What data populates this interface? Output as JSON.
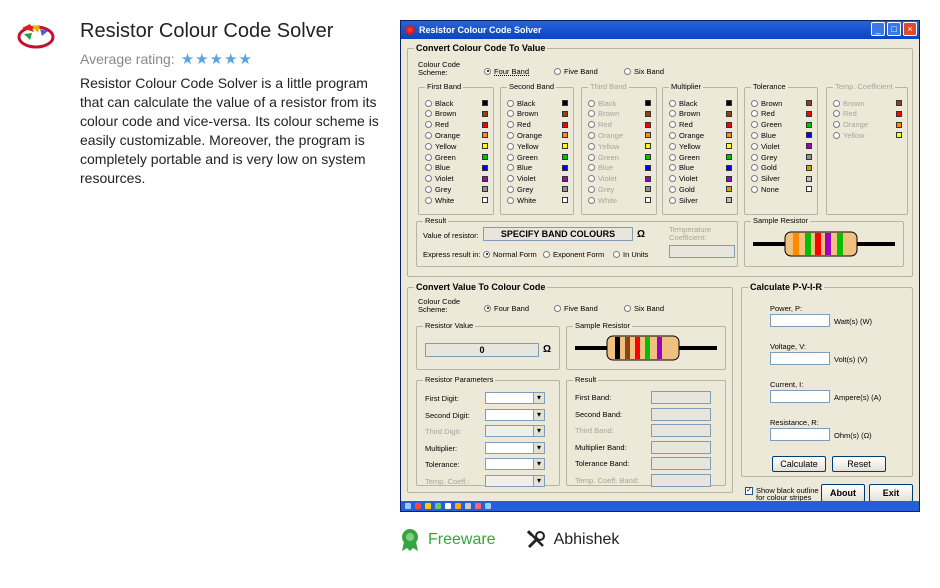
{
  "listing": {
    "title": "Resistor Colour Code Solver",
    "rating_label": "Average rating:",
    "stars": "★★★★★",
    "description": "Resistor Colour Code Solver is a little program that can calculate the value of a resistor from its colour code and vice-versa. Its colour scheme is easily customizable. Moreover, the program is completely portable and is very low on system resources.",
    "license": "Freeware",
    "author": "Abhishek"
  },
  "app": {
    "title": "Resistor Colour Code Solver",
    "c2v": {
      "title": "Convert Colour Code To Value",
      "scheme_label": "Colour Code\nScheme:",
      "schemes": [
        "Four Band",
        "Five Band",
        "Six Band"
      ],
      "bands": [
        {
          "name": "First Band",
          "items": [
            "Black",
            "Brown",
            "Red",
            "Orange",
            "Yellow",
            "Green",
            "Blue",
            "Violet",
            "Grey",
            "White"
          ],
          "colors": [
            "#000000",
            "#8b4513",
            "#ff0000",
            "#ff8c00",
            "#ffff00",
            "#00c000",
            "#0000ff",
            "#a000c0",
            "#909090",
            "#ffffff"
          ]
        },
        {
          "name": "Second Band",
          "items": [
            "Black",
            "Brown",
            "Red",
            "Orange",
            "Yellow",
            "Green",
            "Blue",
            "Violet",
            "Grey",
            "White"
          ],
          "colors": [
            "#000000",
            "#8b4513",
            "#ff0000",
            "#ff8c00",
            "#ffff00",
            "#00c000",
            "#0000ff",
            "#a000c0",
            "#909090",
            "#ffffff"
          ]
        },
        {
          "name": "Third Band",
          "items": [
            "Black",
            "Brown",
            "Red",
            "Orange",
            "Yellow",
            "Green",
            "Blue",
            "Violet",
            "Grey",
            "White"
          ],
          "colors": [
            "#000000",
            "#8b4513",
            "#ff0000",
            "#ff8c00",
            "#ffff00",
            "#00c000",
            "#0000ff",
            "#a000c0",
            "#909090",
            "#ffffff"
          ]
        },
        {
          "name": "Multiplier",
          "items": [
            "Black",
            "Brown",
            "Red",
            "Orange",
            "Yellow",
            "Green",
            "Blue",
            "Violet",
            "Gold",
            "Silver"
          ],
          "colors": [
            "#000000",
            "#8b4513",
            "#ff0000",
            "#ff8c00",
            "#ffff00",
            "#00c000",
            "#0000ff",
            "#a000c0",
            "#c8a800",
            "#c0c0c0"
          ]
        },
        {
          "name": "Tolerance",
          "items": [
            "Brown",
            "Red",
            "Green",
            "Blue",
            "Violet",
            "Grey",
            "Gold",
            "Silver",
            "None"
          ],
          "colors": [
            "#8b4513",
            "#ff0000",
            "#00c000",
            "#0000ff",
            "#a000c0",
            "#909090",
            "#c8a800",
            "#c0c0c0",
            "#ffffff"
          ]
        },
        {
          "name": "Temp. Coefficient",
          "items": [
            "Brown",
            "Red",
            "Orange",
            "Yellow"
          ],
          "colors": [
            "#8b4513",
            "#ff0000",
            "#ff8c00",
            "#ffff00"
          ]
        }
      ],
      "result": {
        "title": "Result",
        "value_label": "Value of resistor:",
        "value": "SPECIFY BAND COLOURS",
        "ohm": "Ω",
        "express_label": "Express result in:",
        "express_options": [
          "Normal Form",
          "Exponent Form",
          "In Units"
        ],
        "temp_label": "Temperature\nCoefficient:"
      },
      "sample_title": "Sample Resistor"
    },
    "v2c": {
      "title": "Convert Value To Colour Code",
      "scheme_label": "Colour Code\nScheme:",
      "schemes": [
        "Four Band",
        "Five Band",
        "Six Band"
      ],
      "resistor_value_title": "Resistor Value",
      "resistor_value": "0",
      "ohm": "Ω",
      "sample_title": "Sample Resistor",
      "params_title": "Resistor Parameters",
      "params": [
        "First Digit:",
        "Second Digit:",
        "Third Digit:",
        "Multiplier:",
        "Tolerance:",
        "Temp. Coeff.:"
      ],
      "result_title": "Result",
      "results": [
        "First Band:",
        "Second Band:",
        "Third Band:",
        "Multiplier Band:",
        "Tolerance Band:",
        "Temp. Coeff. Band:"
      ]
    },
    "pvir": {
      "title": "Calculate P-V-I-R",
      "fields": [
        {
          "label": "Power, P:",
          "unit": "Watt(s) (W)"
        },
        {
          "label": "Voltage, V:",
          "unit": "Volt(s) (V)"
        },
        {
          "label": "Current, I:",
          "unit": "Ampere(s) (A)"
        },
        {
          "label": "Resistance, R:",
          "unit": "Ohm(s) (Ω)"
        }
      ],
      "calculate": "Calculate",
      "reset": "Reset"
    },
    "outline_label": "Show black outline\nfor colour stripes",
    "about": "About",
    "exit": "Exit"
  }
}
